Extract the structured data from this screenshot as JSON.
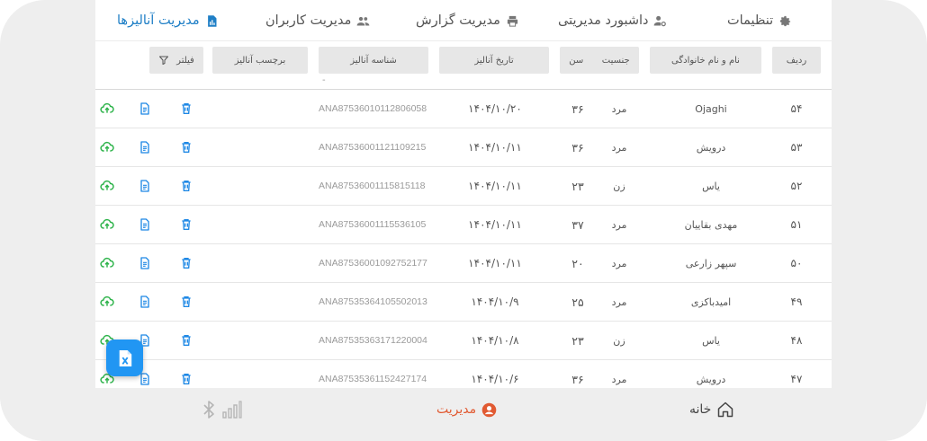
{
  "tabs": [
    {
      "label": "تنظیمات",
      "icon": "gear-icon"
    },
    {
      "label": "داشبورد مدیریتی",
      "icon": "users-gear-icon"
    },
    {
      "label": "مدیریت گزارش",
      "icon": "printer-icon"
    },
    {
      "label": "مدیریت کاربران",
      "icon": "users-icon"
    },
    {
      "label": "مدیریت آنالیزها",
      "icon": "chart-file-icon",
      "active": true
    }
  ],
  "columns": {
    "index": "ردیف",
    "name": "نام و نام خانوادگی",
    "gender": "جنسیت",
    "age": "سن",
    "date": "تاریخ آنالیز",
    "code": "شناسه آنالیز",
    "tag": "برچسب آنالیز",
    "filter": "فیلتر"
  },
  "partial_row_mark": "-",
  "rows": [
    {
      "index": "۵۴",
      "name": "Ojaghi",
      "gender": "مرد",
      "age": "۳۶",
      "date": "۱۴۰۴/۱۰/۲۰",
      "code": "ANA87536010112806058"
    },
    {
      "index": "۵۳",
      "name": "درویش",
      "gender": "مرد",
      "age": "۳۶",
      "date": "۱۴۰۴/۱۰/۱۱",
      "code": "ANA87536001121109215"
    },
    {
      "index": "۵۲",
      "name": "یاس",
      "gender": "زن",
      "age": "۲۳",
      "date": "۱۴۰۴/۱۰/۱۱",
      "code": "ANA87536001115815118"
    },
    {
      "index": "۵۱",
      "name": "مهدی بقاییان",
      "gender": "مرد",
      "age": "۳۷",
      "date": "۱۴۰۴/۱۰/۱۱",
      "code": "ANA87536001115536105"
    },
    {
      "index": "۵۰",
      "name": "سپهر زارعی",
      "gender": "مرد",
      "age": "۲۰",
      "date": "۱۴۰۴/۱۰/۱۱",
      "code": "ANA87536001092752177"
    },
    {
      "index": "۴۹",
      "name": "امیدباکزی",
      "gender": "مرد",
      "age": "۲۵",
      "date": "۱۴۰۴/۱۰/۹",
      "code": "ANA87535364105502013"
    },
    {
      "index": "۴۸",
      "name": "یاس",
      "gender": "زن",
      "age": "۲۳",
      "date": "۱۴۰۴/۱۰/۸",
      "code": "ANA87535363171220004"
    },
    {
      "index": "۴۷",
      "name": "درویش",
      "gender": "مرد",
      "age": "۳۶",
      "date": "۱۴۰۴/۱۰/۶",
      "code": "ANA87535361152427174"
    }
  ],
  "bottom_nav": {
    "home": "خانه",
    "manage": "مدیریت"
  },
  "colors": {
    "active_tab": "#1f7fc6",
    "upload_icon": "#2db34a",
    "doc_icon": "#1e88e5",
    "trash_icon": "#1e88e5",
    "fab": "#2196f3",
    "manage_nav": "#e15a32"
  }
}
